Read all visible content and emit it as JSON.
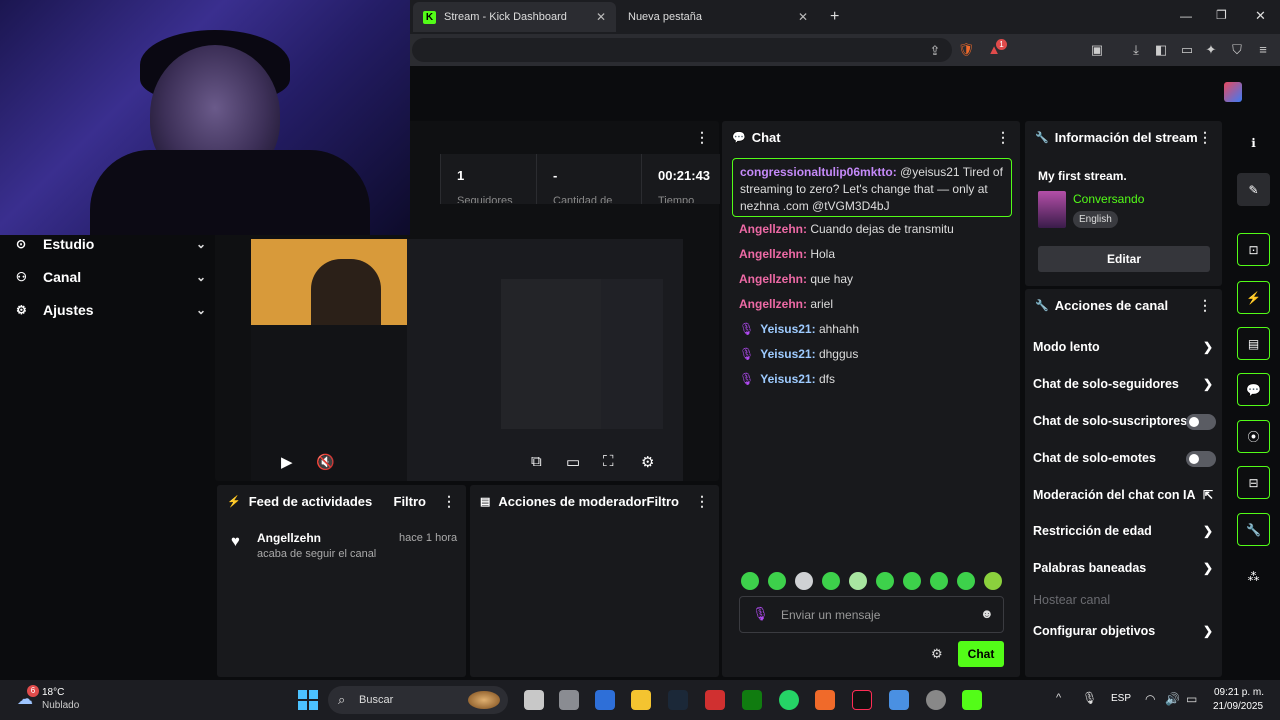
{
  "browser": {
    "active_tab": "Stream - Kick Dashboard",
    "tab_icon": "K",
    "second_tab": "Nueva pestaña",
    "new_tab": "+",
    "shield_badge": "1"
  },
  "nav": {
    "items": [
      {
        "label": "Estudio"
      },
      {
        "label": "Canal"
      },
      {
        "label": "Ajustes"
      }
    ]
  },
  "stats": {
    "followers_value": "1",
    "followers_label": "Seguidores",
    "count_value": "-",
    "count_label": "Cantidad de",
    "time_value": "00:21:43",
    "time_label": "Tiempo"
  },
  "activity": {
    "title": "Feed de actividades",
    "filter": "Filtro",
    "user": "Angellzehn",
    "time": "hace 1 hora",
    "action": "acaba de seguir el canal"
  },
  "moderator": {
    "title": "Acciones de moderador",
    "filter": "Filtro"
  },
  "chat": {
    "title": "Chat",
    "highlight_user": "congressionaltulip06mkttо:",
    "highlight_text": " @yeisus21 Tired of streaming to zero? Let's change that — only at nezhna .com @tVGM3D4bJ",
    "messages": [
      {
        "user": "Angellzehn:",
        "text": " Cuando dejas de transmitu"
      },
      {
        "user": "Angellzehn:",
        "text": " Hola"
      },
      {
        "user": "Angellzehn:",
        "text": " que hay"
      },
      {
        "user": "Angellzehn:",
        "text": " ariel"
      },
      {
        "user": "Yeisus21:",
        "text": " ahhahh"
      },
      {
        "user": "Yeisus21:",
        "text": " dhggus"
      },
      {
        "user": "Yeisus21:",
        "text": " dfs"
      }
    ],
    "input_placeholder": "Enviar un mensaje",
    "send_label": "Chat"
  },
  "stream_info": {
    "title": "Información del stream",
    "stream_title": "My first stream.",
    "category": "Conversando",
    "language": "English",
    "edit_label": "Editar"
  },
  "channel_actions": {
    "title": "Acciones de canal",
    "items": [
      {
        "label": "Modo lento"
      },
      {
        "label": "Chat de solo-seguidores"
      },
      {
        "label": "Chat de solo-suscriptores"
      },
      {
        "label": "Chat de solo-emotes"
      },
      {
        "label": "Moderación del chat con IA"
      },
      {
        "label": "Restricción de edad"
      },
      {
        "label": "Palabras baneadas"
      },
      {
        "label": "Hostear canal"
      },
      {
        "label": "Configurar objetivos"
      }
    ]
  },
  "taskbar": {
    "weather_temp": "18°C",
    "weather_desc": "Nublado",
    "weather_badge": "6",
    "search_placeholder": "Buscar",
    "lang": "ESP",
    "time": "09:21 p. m.",
    "date": "21/09/2025"
  },
  "colors": {
    "accent": "#53fc18",
    "chat_user": "#ee6aa6",
    "panel": "#18191c"
  }
}
